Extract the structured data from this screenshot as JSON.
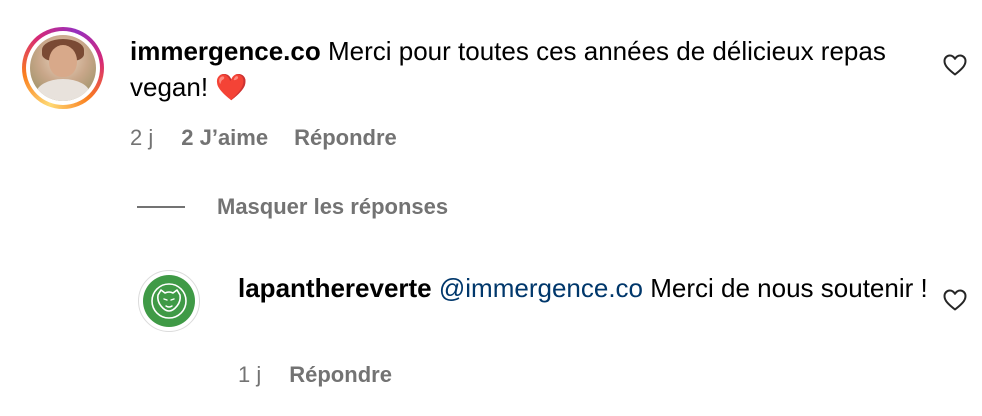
{
  "comments": [
    {
      "username": "immergence.co",
      "text": " Merci pour toutes ces années de délicieux repas vegan! ",
      "emoji": "❤️",
      "time": "2 j",
      "likes": "2 J’aime",
      "reply_label": "Répondre",
      "avatar_icon": "profile-photo"
    }
  ],
  "hide_replies_label": "Masquer les réponses",
  "replies": [
    {
      "username": "lapanthereverte",
      "mention": "@immergence.co",
      "text": " Merci de nous soutenir !",
      "time": "1 j",
      "reply_label": "Répondre",
      "avatar_icon": "panther-logo"
    }
  ],
  "icons": {
    "like": "heart-outline-icon"
  },
  "colors": {
    "secondary_text": "#737373",
    "mention": "#00376b",
    "brand_green": "#3f9a46",
    "story_ring_start": "#feda75",
    "story_ring_end": "#d62976"
  }
}
